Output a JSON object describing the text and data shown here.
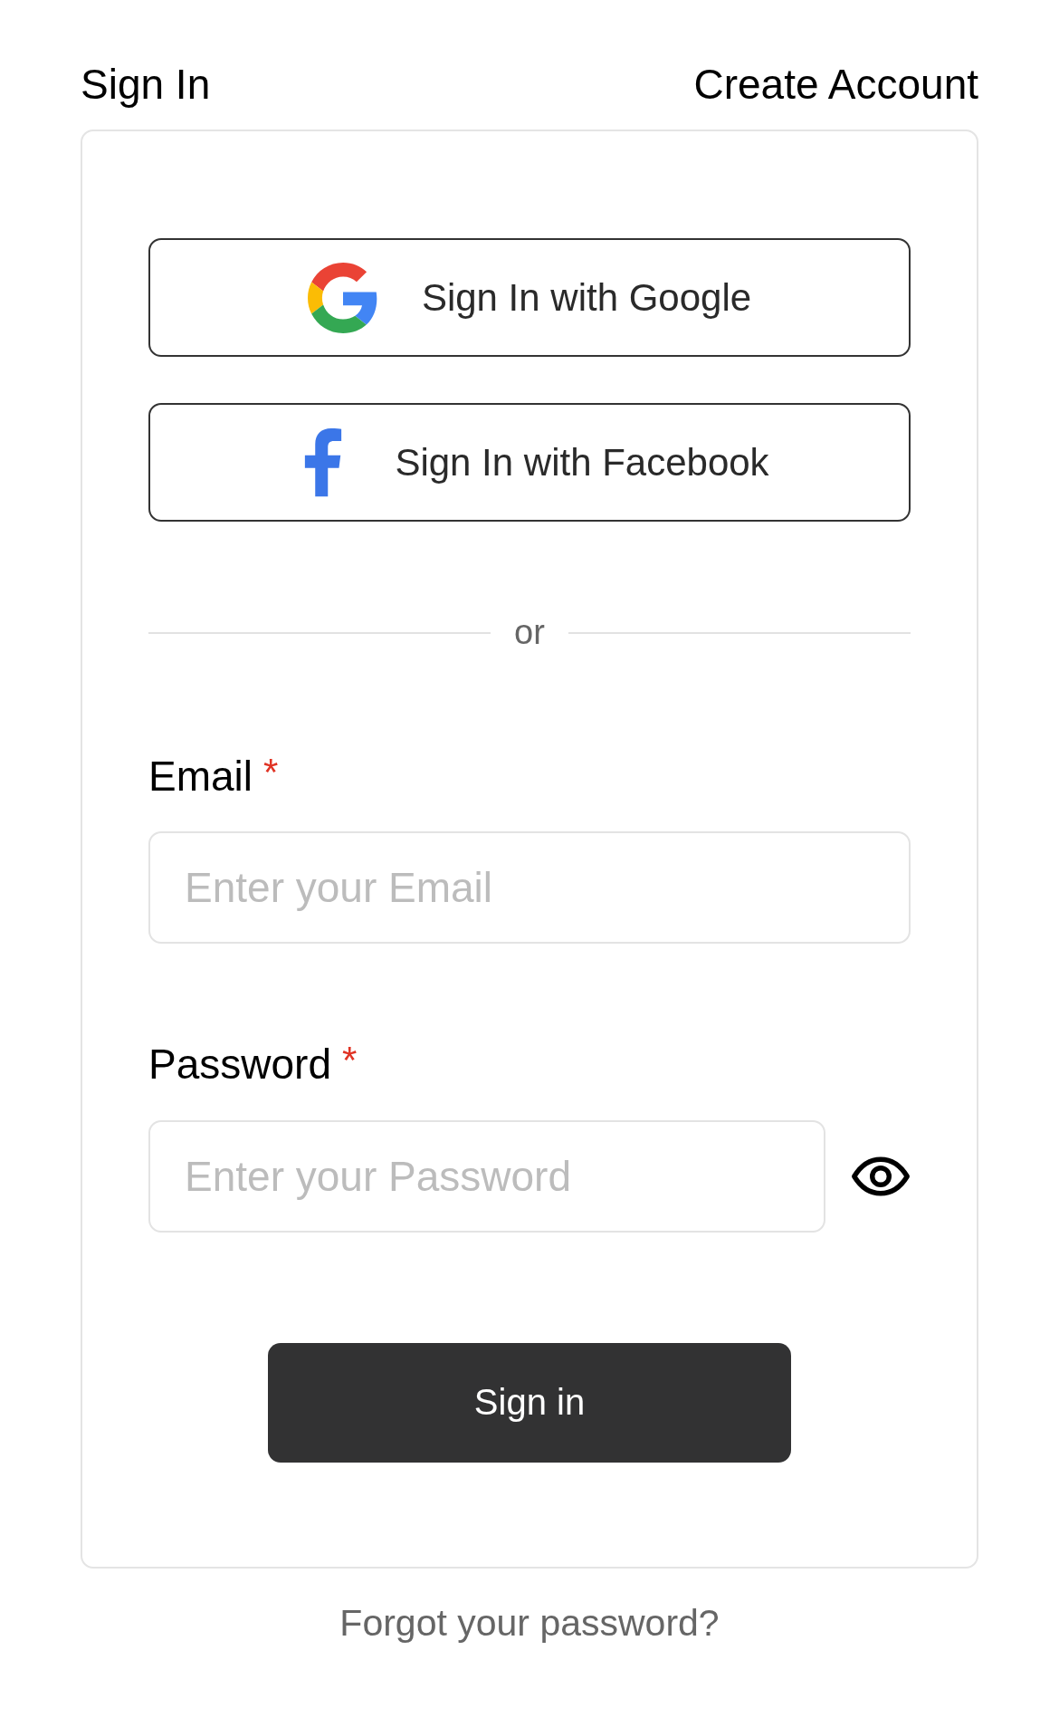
{
  "tabs": [
    {
      "label": "Sign In"
    },
    {
      "label": "Create Account"
    }
  ],
  "social_buttons": [
    {
      "kind": "google",
      "label": "Sign In with Google"
    },
    {
      "kind": "facebook",
      "label": "Sign In with Facebook"
    }
  ],
  "divider": {
    "label": "or"
  },
  "fields": [
    {
      "label": "Email",
      "required_mark": "*",
      "placeholder": "Enter your Email",
      "reveal_toggle": false
    },
    {
      "label": "Password",
      "required_mark": "*",
      "placeholder": "Enter your Password",
      "reveal_toggle": true
    }
  ],
  "submit_button": {
    "label": "Sign in"
  },
  "forgot_link": {
    "label": "Forgot your password?"
  }
}
